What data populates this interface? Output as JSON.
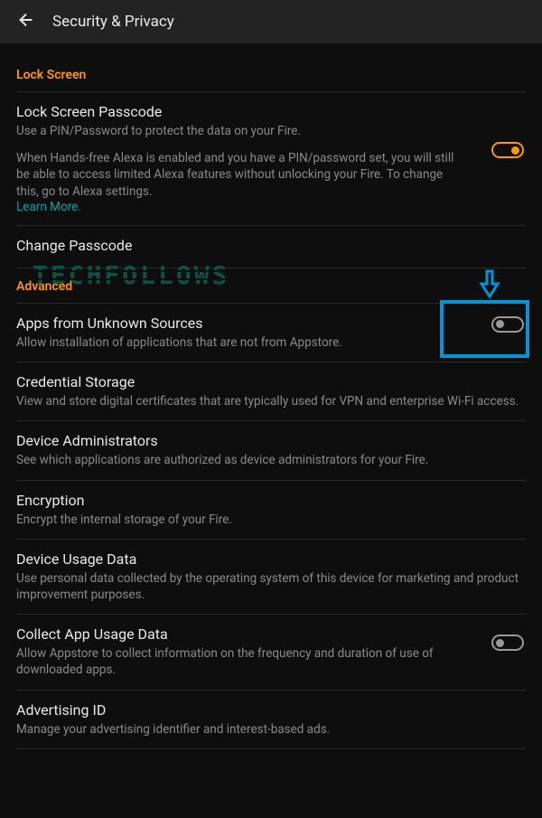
{
  "header": {
    "title": "Security & Privacy"
  },
  "sections": {
    "lock_screen": {
      "header": "Lock Screen",
      "passcode": {
        "title": "Lock Screen Passcode",
        "desc": "Use a PIN/Password to protect the data on your Fire.",
        "desc2": "When Hands-free Alexa is enabled and you have a PIN/password set, you will still be able to access limited Alexa features without unlocking your Fire. To change this, go to Alexa settings.",
        "learn_more": "Learn More."
      },
      "change_passcode": {
        "title": "Change Passcode"
      }
    },
    "advanced": {
      "header": "Advanced",
      "unknown_sources": {
        "title": "Apps from Unknown Sources",
        "desc": "Allow installation of applications that are not from Appstore."
      },
      "credential": {
        "title": "Credential Storage",
        "desc": "View and store digital certificates that are typically used for VPN and enterprise Wi-Fi access."
      },
      "device_admins": {
        "title": "Device Administrators",
        "desc": "See which applications are authorized as device administrators for your Fire."
      },
      "encryption": {
        "title": "Encryption",
        "desc": "Encrypt the internal storage of your Fire."
      },
      "device_usage": {
        "title": "Device Usage Data",
        "desc": "Use personal data collected by the operating system of this device for marketing and product improvement purposes."
      },
      "collect_app": {
        "title": "Collect App Usage Data",
        "desc": "Allow Appstore to collect information on the frequency and duration of use of downloaded apps."
      },
      "advertising": {
        "title": "Advertising ID",
        "desc": "Manage your advertising identifier and interest-based ads."
      }
    }
  },
  "watermark": "TECHFOLLOWS"
}
